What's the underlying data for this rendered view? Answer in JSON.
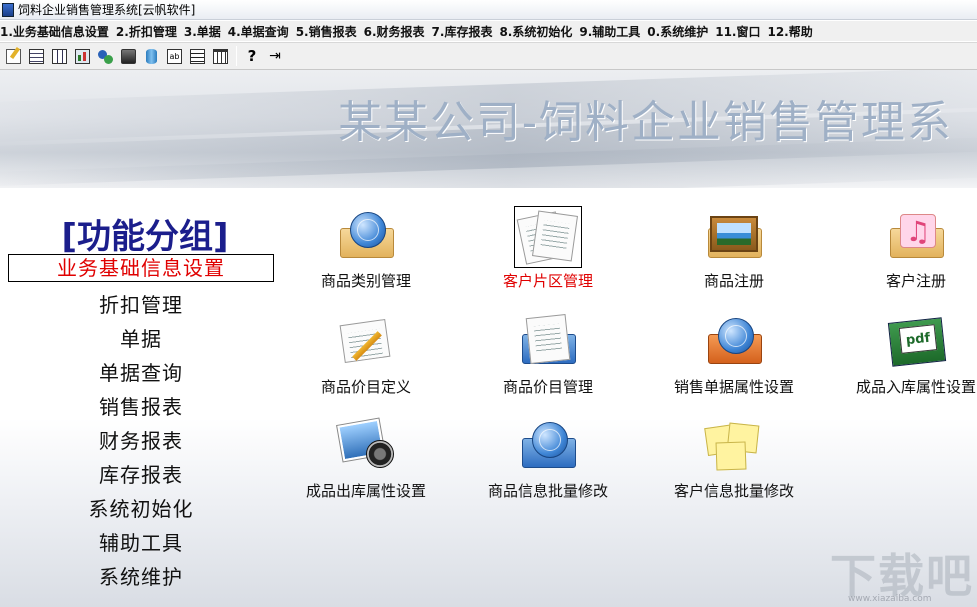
{
  "window": {
    "title": "饲料企业销售管理系统[云帆软件]"
  },
  "menu": [
    "1.业务基础信息设置",
    "2.折扣管理",
    "3.单据",
    "4.单据查询",
    "5.销售报表",
    "6.财务报表",
    "7.库存报表",
    "8.系统初始化",
    "9.辅助工具",
    "0.系统维护",
    "11.窗口",
    "12.帮助"
  ],
  "toolbar": {
    "icons": [
      "edit-icon",
      "form-icon",
      "grid-icon",
      "report-icon",
      "transfer-icon",
      "stock-icon",
      "database-icon",
      "ledger-icon",
      "list-icon",
      "calendar-icon",
      "help-icon",
      "exit-icon"
    ]
  },
  "banner": {
    "title": "某某公司-饲料企业销售管理系"
  },
  "sidebar": {
    "heading": "[功能分组]",
    "items": [
      "业务基础信息设置",
      "折扣管理",
      "单据",
      "单据查询",
      "销售报表",
      "财务报表",
      "库存报表",
      "系统初始化",
      "辅助工具",
      "系统维护"
    ],
    "active_index": 0
  },
  "tiles": [
    {
      "label": "商品类别管理",
      "icon": "globe-folder-icon"
    },
    {
      "label": "客户片区管理",
      "icon": "documents-icon",
      "selected": true
    },
    {
      "label": "商品注册",
      "icon": "picture-folder-icon"
    },
    {
      "label": "客户注册",
      "icon": "music-folder-icon"
    },
    {
      "label": "商品价目定义",
      "icon": "note-pencil-icon"
    },
    {
      "label": "商品价目管理",
      "icon": "documents-stack-icon"
    },
    {
      "label": "销售单据属性设置",
      "icon": "globe-book-icon"
    },
    {
      "label": "成品入库属性设置",
      "icon": "pdf-files-icon"
    },
    {
      "label": "成品出库属性设置",
      "icon": "photo-camera-icon"
    },
    {
      "label": "商品信息批量修改",
      "icon": "globe-folder-blue-icon"
    },
    {
      "label": "客户信息批量修改",
      "icon": "sticky-notes-icon"
    }
  ],
  "colors": {
    "active": "#e00000",
    "heading": "#1b1e8c",
    "banner_text": "#9fb0c6"
  },
  "watermark": {
    "text": "下载吧",
    "url": "www.xiazaiba.com"
  }
}
